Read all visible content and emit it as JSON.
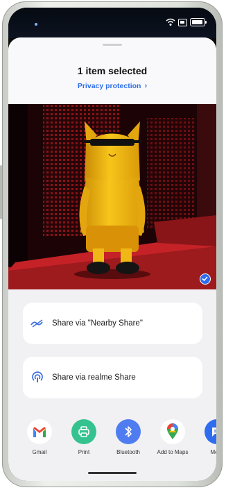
{
  "share_sheet": {
    "title": "1 item selected",
    "privacy_link": "Privacy protection",
    "options": [
      {
        "label": "Share via \"Nearby Share\"",
        "icon": "nearby-share-icon"
      },
      {
        "label": "Share via realme Share",
        "icon": "realme-share-icon"
      }
    ],
    "apps": [
      {
        "label": "Gmail",
        "icon": "gmail-icon",
        "color": "#ffffff"
      },
      {
        "label": "Print",
        "icon": "printer-icon",
        "color": "#34c38f"
      },
      {
        "label": "Bluetooth",
        "icon": "bluetooth-icon",
        "color": "#4f7cf0"
      },
      {
        "label": "Add to Maps",
        "icon": "maps-pin-icon",
        "color": "#ffffff"
      },
      {
        "label": "Mess",
        "icon": "messages-icon",
        "color": "#2f6df0"
      }
    ]
  },
  "photo": {
    "subject": "yellow cat figurine with sunglasses",
    "selected": true,
    "accent": "#2f6df0"
  },
  "colors": {
    "link": "#2e6ee8",
    "sheet_bg": "#f1f1f3",
    "card_bg": "#ffffff"
  }
}
